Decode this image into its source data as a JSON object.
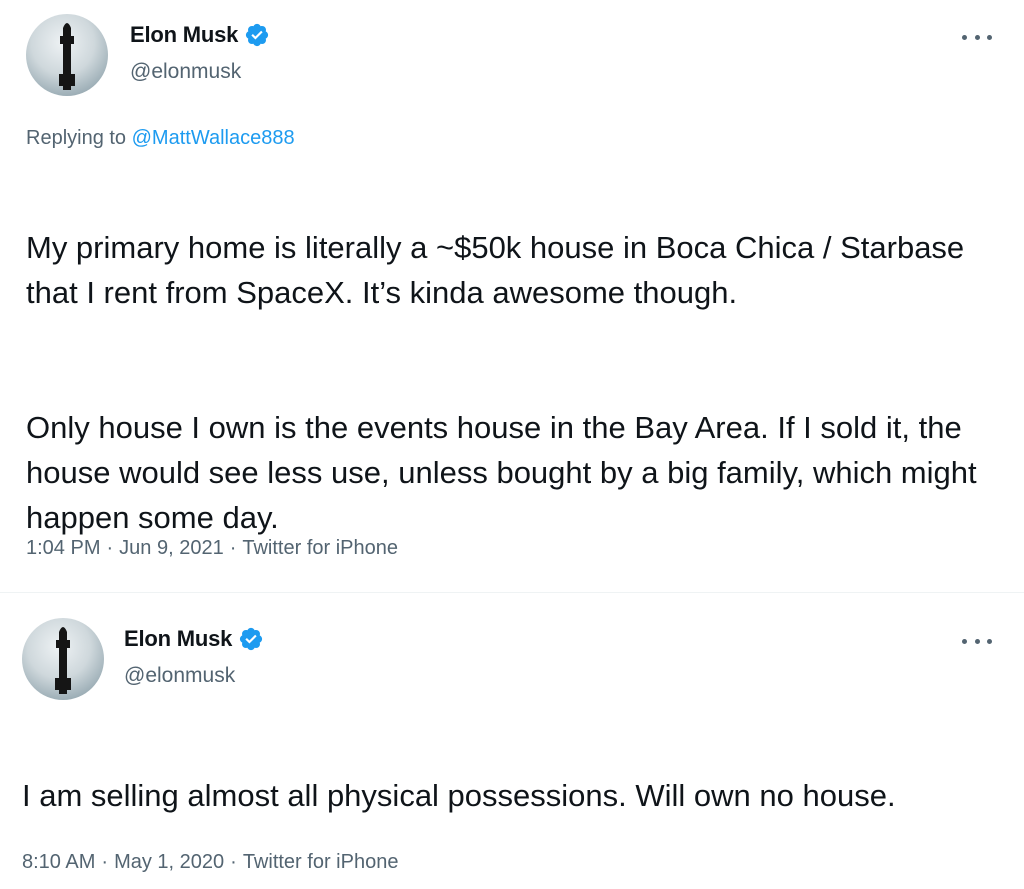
{
  "tweets": [
    {
      "author": {
        "display_name": "Elon Musk",
        "handle": "@elonmusk",
        "verified": true,
        "avatar_icon": "avatar-starship-icon"
      },
      "replying_to": {
        "prefix": "Replying to",
        "mention": "@MattWallace888"
      },
      "paragraphs": [
        "My primary home is literally a ~$50k house in Boca Chica / Starbase that I rent from SpaceX. It’s kinda awesome though.",
        "Only house I own is the events house in the Bay Area. If I sold it, the house would see less use, unless bought by a big family, which might happen some day."
      ],
      "time": "1:04 PM",
      "date": "Jun 9, 2021",
      "source": "Twitter for iPhone",
      "separator": "·"
    },
    {
      "author": {
        "display_name": "Elon Musk",
        "handle": "@elonmusk",
        "verified": true,
        "avatar_icon": "avatar-starship-icon"
      },
      "paragraphs": [
        "I am selling almost all physical possessions. Will own no house."
      ],
      "time": "8:10 AM",
      "date": "May 1, 2020",
      "source": "Twitter for iPhone",
      "separator": "·"
    }
  ],
  "colors": {
    "text_primary": "#0f1419",
    "text_secondary": "#536471",
    "accent": "#1d9bf0"
  }
}
